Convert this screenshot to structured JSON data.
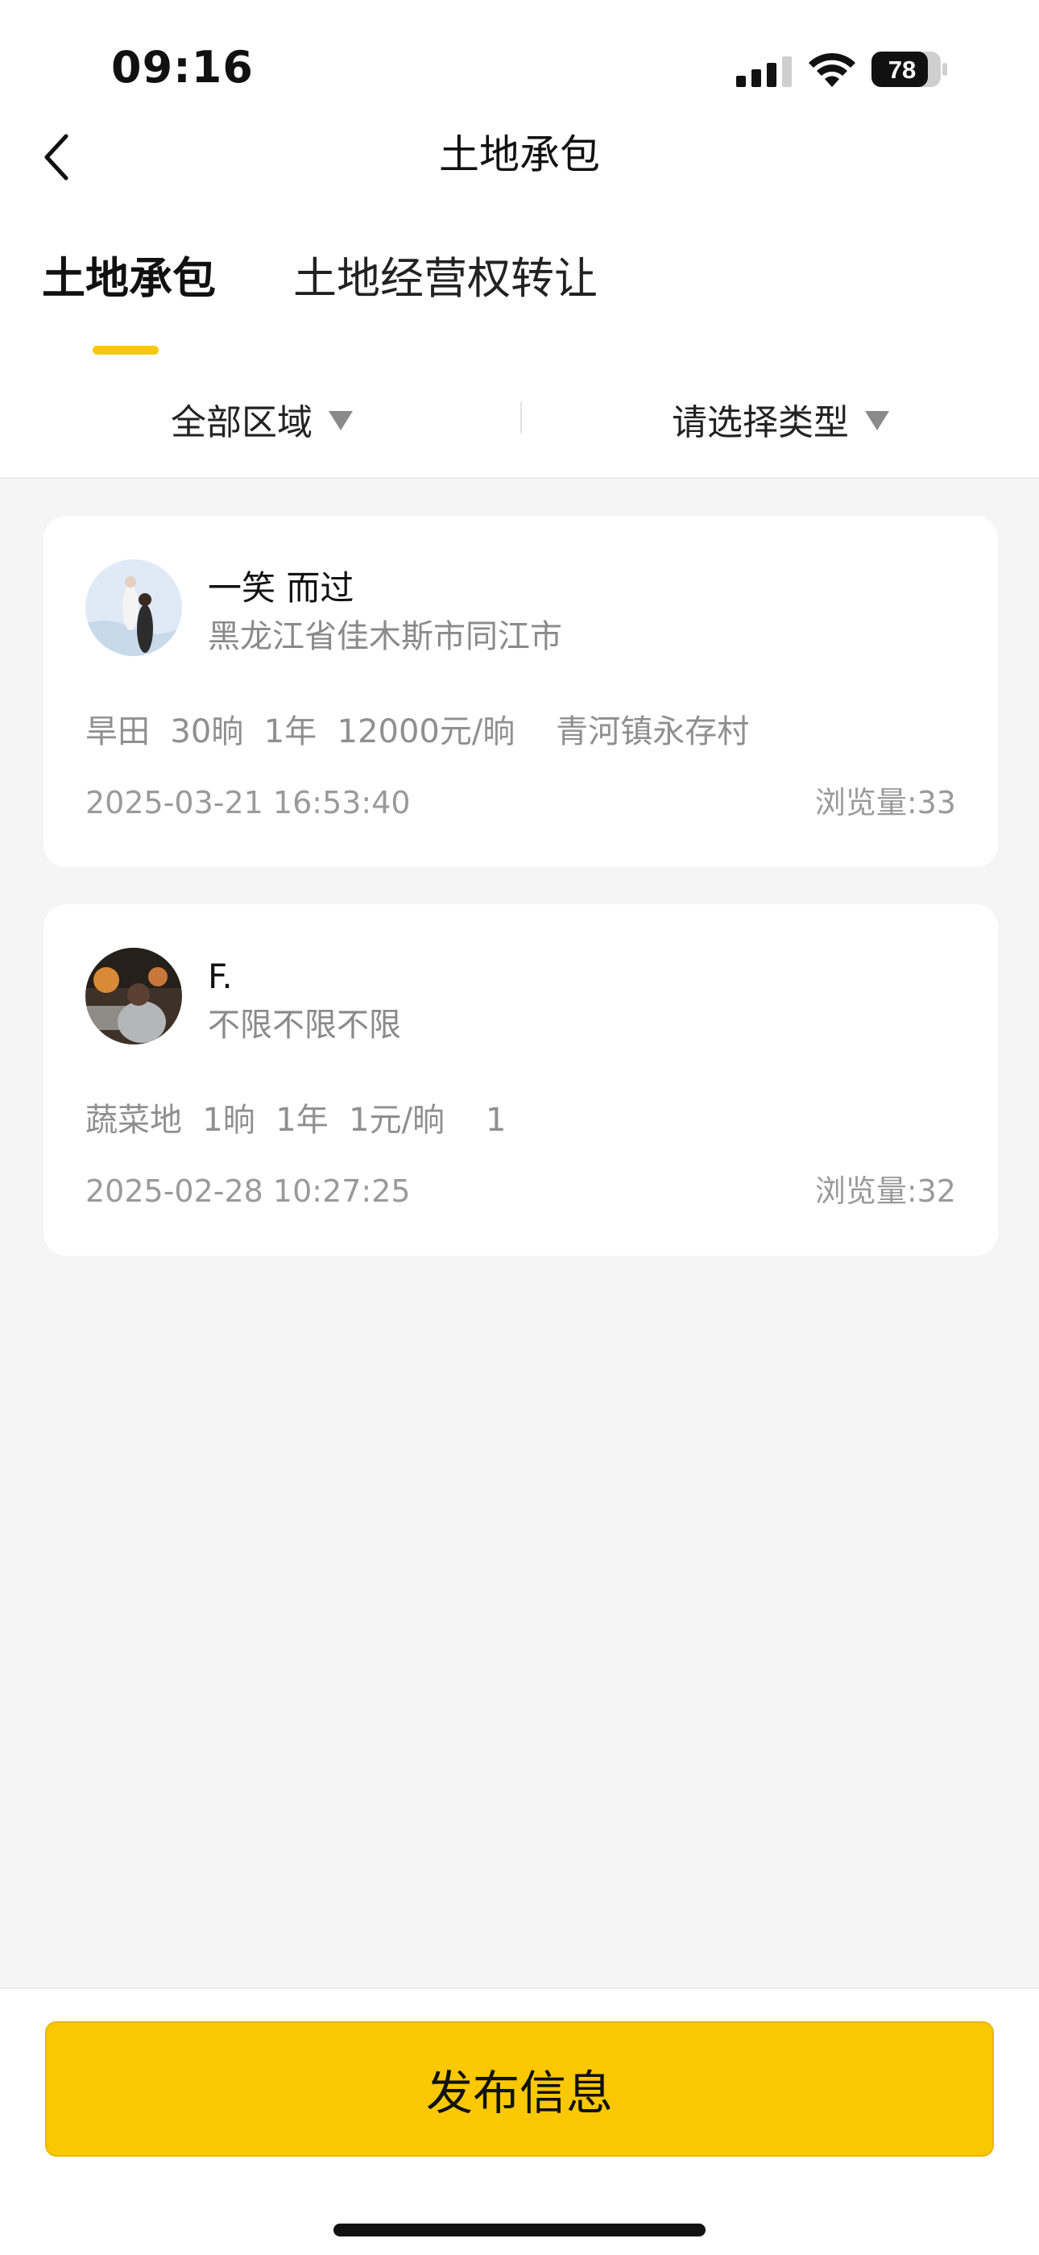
{
  "status_bar": {
    "time": "09:16",
    "battery": "78"
  },
  "nav": {
    "title": "土地承包"
  },
  "tabs": [
    {
      "label": "土地承包",
      "active": true
    },
    {
      "label": "土地经营权转让",
      "active": false
    }
  ],
  "filters": {
    "region": "全部区域",
    "type": "请选择类型"
  },
  "listings": [
    {
      "name": "一笑 而过",
      "location": "黑龙江省佳木斯市同江市",
      "info": "旱田  30晌  1年  12000元/晌    青河镇永存村",
      "date": "2025-03-21 16:53:40",
      "views": "浏览量:33"
    },
    {
      "name": "F.",
      "location": "不限不限不限",
      "info": "蔬菜地  1晌  1年  1元/晌    1",
      "date": "2025-02-28 10:27:25",
      "views": "浏览量:32"
    }
  ],
  "publish_button": "发布信息",
  "colors": {
    "accent": "#fac800",
    "background": "#f5f5f5",
    "muted_text": "#8a8a8a"
  }
}
